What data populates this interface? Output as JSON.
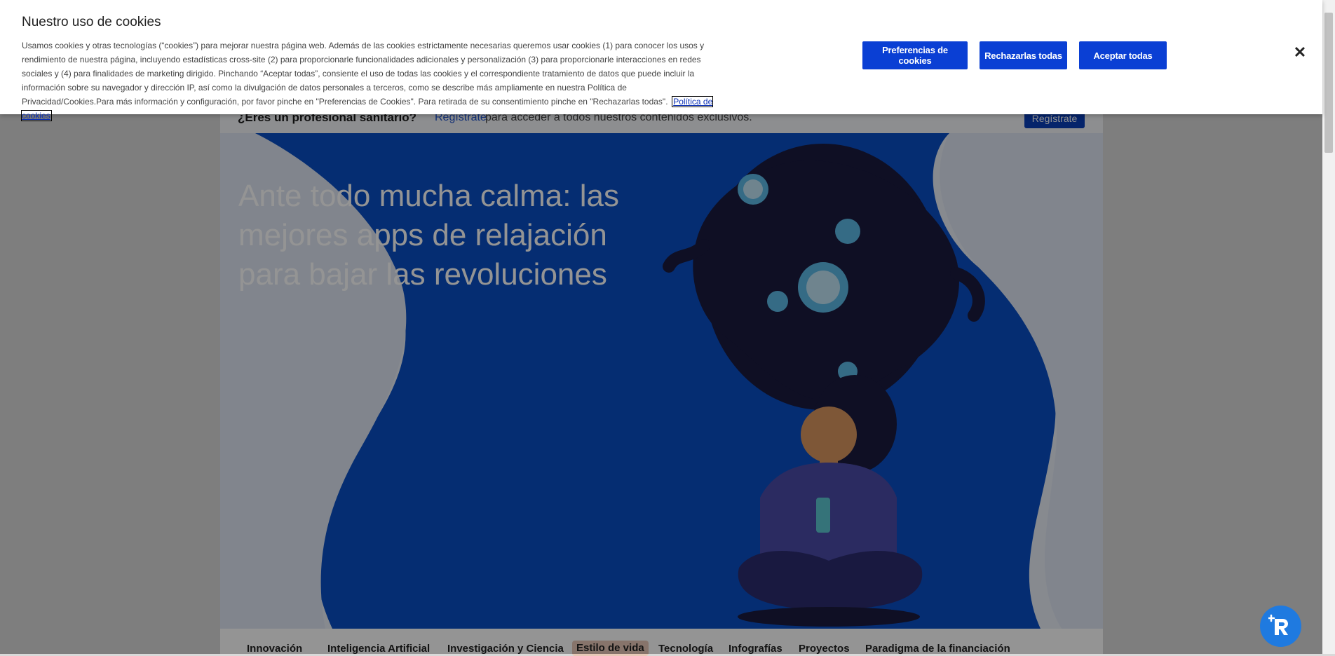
{
  "pro_bar": {
    "question": "¿Eres un profesional sanitario?",
    "link": "Regístrate",
    "rest": "para acceder a todos nuestros contenidos exclusivos.",
    "button": "Regístrate"
  },
  "hero": {
    "title": "Ante todo mucha calma: las mejores apps de relajación para bajar las revoluciones"
  },
  "nav": {
    "items": [
      "Innovación",
      "Inteligencia Artificial",
      "Investigación y Ciencia",
      "Estilo de vida",
      "Tecnología",
      "Infografías",
      "Proyectos",
      "Paradigma de la financiación"
    ]
  },
  "cookie_banner": {
    "title": "Nuestro uso de cookies",
    "text": "Usamos cookies y otras tecnologías (“cookies”) para mejorar nuestra página web. Además de las cookies estrictamente necesarias queremos usar cookies (1) para conocer los usos y rendimiento de nuestra página, incluyendo estadísticas cross-site (2) para proporcionarle funcionalidades adicionales y personalización (3) para proporcionarle interacciones en redes sociales y (4) para finalidades de marketing dirigido. Pinchando “Aceptar todas”, consiente el uso de todas las cookies y el correspondiente tratamiento de datos que puede incluir la información sobre su navegador y dirección IP, así como la divulgación de datos personales a terceros, como se describe más ampliamente en nuestra Política de Privacidad/Cookies.Para más información y configuración, por favor pinche en \"Preferencias de Cookies\". Para retirada de su consentimiento pinche en \"Rechazarlas todas\".",
    "policy_link": "Política de cookies",
    "preferences_button": "Preferencias de cookies",
    "reject_button": "Rechazarlas todas",
    "accept_button": "Aceptar todas",
    "close_icon": "close-icon"
  },
  "colors": {
    "accent": "#0a3fd4",
    "hero_blue": "#0a4fc4",
    "fab": "#1f7ae0"
  }
}
